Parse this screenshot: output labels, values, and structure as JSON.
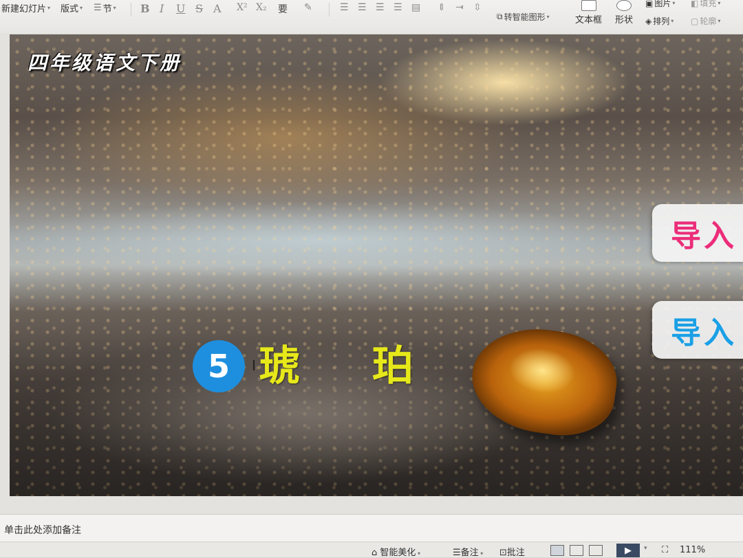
{
  "toolbar": {
    "new_slide": "新建幻灯片",
    "layout": "版式",
    "section": "节",
    "bold": "B",
    "italic": "I",
    "underline": "U",
    "strike": "S",
    "font_color": "A",
    "superscript": "X²",
    "subscript": "X₂",
    "phonetic": "要",
    "smart_shape": "转智能图形",
    "text_box": "文本框",
    "shape": "形状",
    "picture": "图片",
    "fill": "填充",
    "arrange": "排列",
    "outline": "轮廓"
  },
  "slide": {
    "top_title": "四年级语文下册",
    "number": "5",
    "lesson_title": "琥 珀",
    "button_pink": "导入",
    "button_blue": "导入"
  },
  "notes": {
    "placeholder": "单击此处添加备注"
  },
  "statusbar": {
    "smart_beautify": "智能美化",
    "notes_btn": "备注",
    "comments_btn": "批注",
    "zoom": "111%"
  },
  "colors": {
    "pink": "#ec2d7a",
    "blue": "#1aa0e6",
    "yellow": "#e6e81a",
    "number_bg": "#1e8fdf"
  }
}
